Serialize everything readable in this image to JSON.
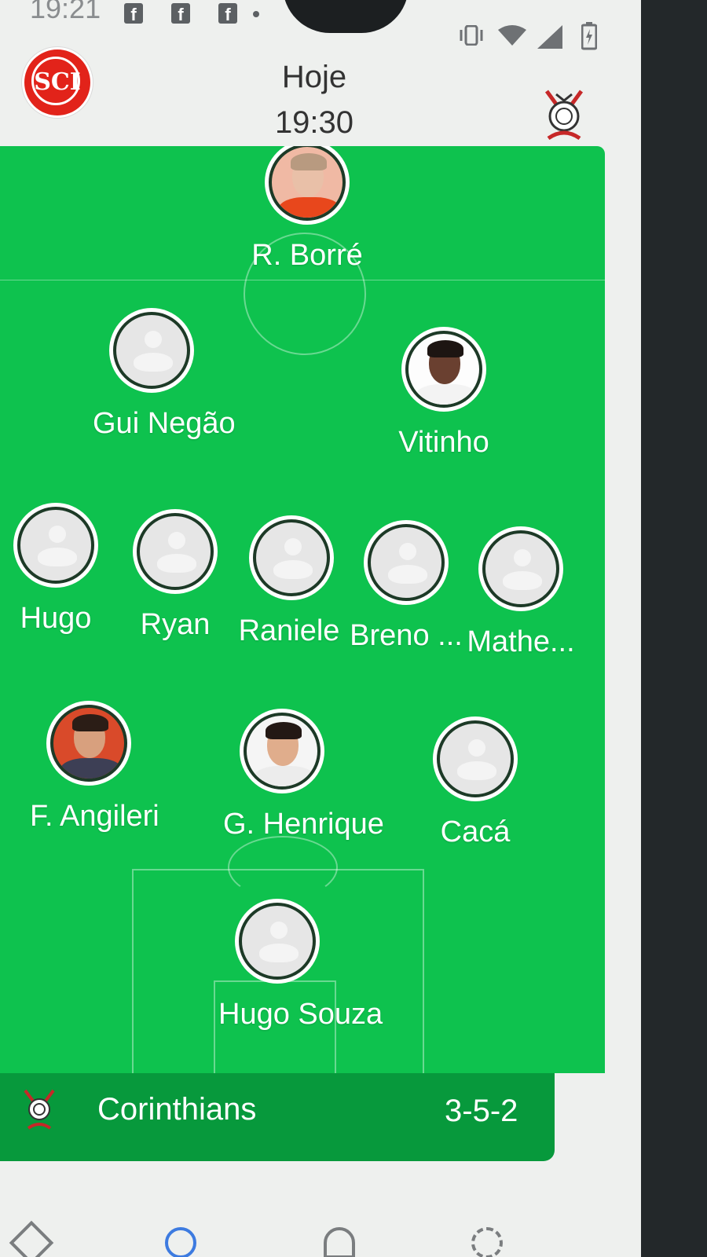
{
  "status_bar": {
    "time": "19:21",
    "notifications": [
      "f",
      "f",
      "f"
    ],
    "icons": [
      "vibrate-icon",
      "wifi-icon",
      "signal-icon",
      "battery-charging-icon"
    ]
  },
  "header": {
    "match_day": "Hoje",
    "match_time": "19:30",
    "home_team_logo": "internacional-crest-icon",
    "home_team_monogram": "SCI",
    "away_team_logo": "corinthians-crest-icon"
  },
  "lineup": {
    "team": "Corinthians",
    "formation": "3-5-2",
    "players": [
      {
        "name": "R. Borré",
        "photo": "photo"
      },
      {
        "name": "Gui Negão",
        "photo": "placeholder"
      },
      {
        "name": "Vitinho",
        "photo": "photo"
      },
      {
        "name": "Hugo",
        "photo": "placeholder"
      },
      {
        "name": "Ryan",
        "photo": "placeholder"
      },
      {
        "name": "Raniele",
        "photo": "placeholder"
      },
      {
        "name": "Breno ...",
        "photo": "placeholder"
      },
      {
        "name": "Mathe...",
        "photo": "placeholder"
      },
      {
        "name": "F. Angileri",
        "photo": "photo"
      },
      {
        "name": "G. Henrique",
        "photo": "photo"
      },
      {
        "name": "Cacá",
        "photo": "placeholder"
      },
      {
        "name": "Hugo Souza",
        "photo": "placeholder"
      }
    ]
  },
  "colors": {
    "pitch": "#0ec24e",
    "team_bar": "#07993c",
    "internacional_red": "#e2231a"
  }
}
